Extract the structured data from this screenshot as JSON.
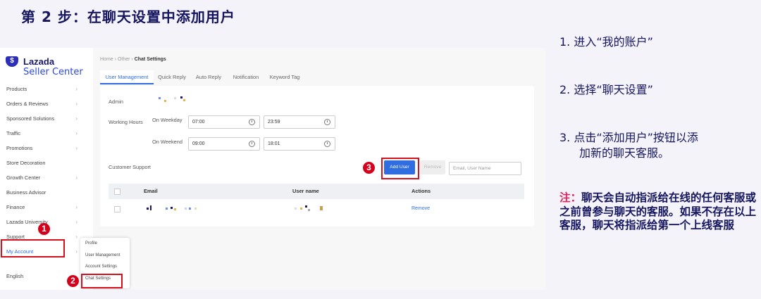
{
  "slide": {
    "title": "第 2 步：在聊天设置中添加用户"
  },
  "logo": {
    "badge": "$",
    "name": "Lazada",
    "sub": "Seller Center"
  },
  "sidebar": {
    "items": [
      {
        "label": "Products",
        "chev": "›"
      },
      {
        "label": "Orders & Reviews",
        "chev": "›"
      },
      {
        "label": "Sponsored Solutions",
        "chev": "›"
      },
      {
        "label": "Traffic",
        "chev": "›"
      },
      {
        "label": "Promotions",
        "chev": "›"
      },
      {
        "label": "Store Decoration",
        "chev": ""
      },
      {
        "label": "Growth Center",
        "chev": "›"
      },
      {
        "label": "Business Advisor",
        "chev": ""
      },
      {
        "label": "Finance",
        "chev": "›"
      },
      {
        "label": "Lazada University",
        "chev": "›"
      },
      {
        "label": "Support",
        "chev": "›"
      },
      {
        "label": "My Account",
        "chev": "›"
      }
    ],
    "language": "English"
  },
  "submenu": [
    "Profile",
    "User Management",
    "Account Settings",
    "Chat Settings"
  ],
  "breadcrumb": {
    "home": "Home",
    "sep1": "›",
    "other": "Other",
    "sep2": "›",
    "current": "Chat Settings"
  },
  "tabs": [
    "User Management",
    "Quick Reply",
    "Auto Reply",
    "Notification",
    "Keyword Tag"
  ],
  "form": {
    "admin_label": "Admin",
    "working_hours_label": "Working Hours",
    "weekday_label": "On Weekday",
    "weekday_start": "07:00",
    "weekday_end": "23:59",
    "weekend_label": "On Weekend",
    "weekend_start": "09:00",
    "weekend_end": "18:01",
    "customer_support_label": "Customer Support",
    "add_user": "Add User",
    "remove": "Remove",
    "search_placeholder": "Email, User Name"
  },
  "table": {
    "headers": [
      "Email",
      "User name",
      "Actions"
    ],
    "row_action": "Remove"
  },
  "badges": [
    "1",
    "2",
    "3"
  ],
  "steps": [
    "1.  进入“我的账户”",
    "2.  选择“聊天设置”",
    "3.  点击“添加用户”按钮以添",
    "加新的聊天客服。"
  ],
  "note": {
    "prefix": "注：",
    "body": "聊天会自动指派给在线的任何客服或之前曾参与聊天的客服。如果不存在以上客服，聊天将指派给第一个上线客服"
  },
  "colors": {
    "accent": "#2f6de1",
    "highlight": "#d7101d",
    "title": "#15155f"
  }
}
